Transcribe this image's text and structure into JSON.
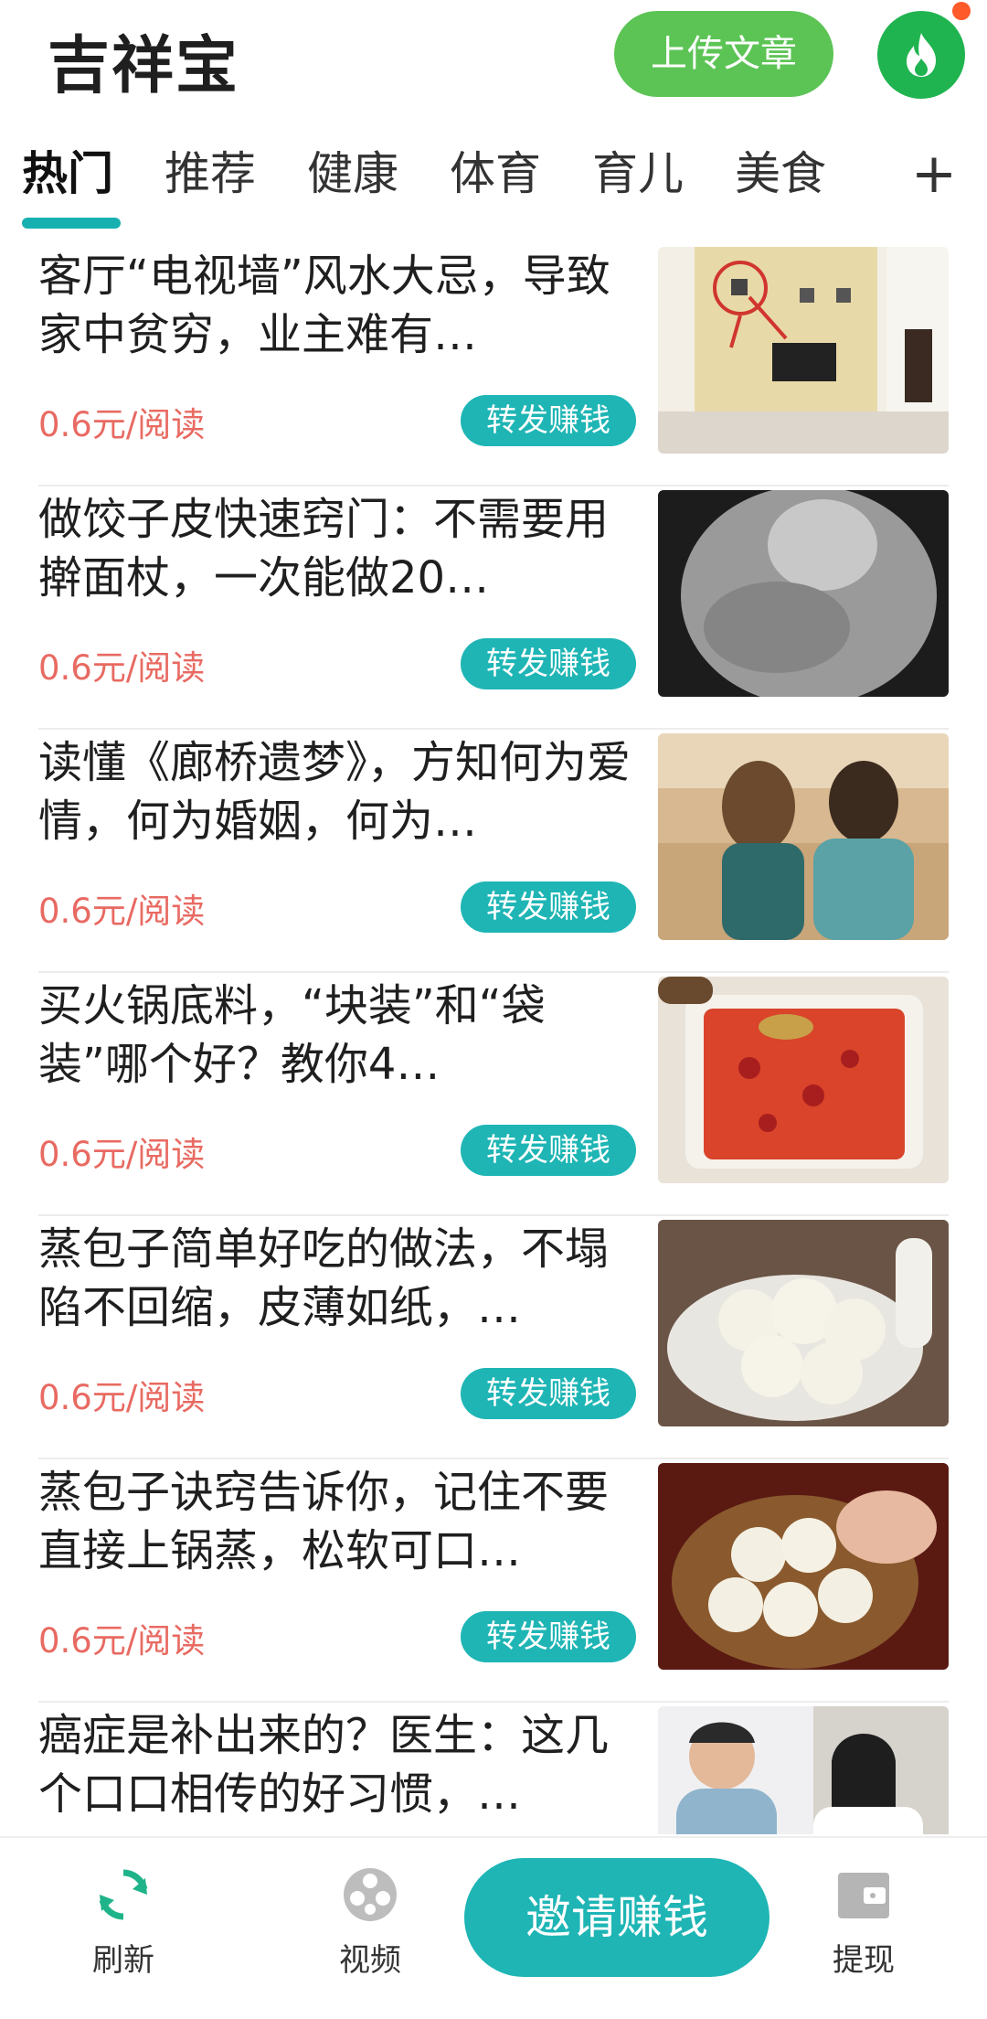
{
  "header": {
    "app_title": "吉祥宝",
    "upload_label": "上传文章"
  },
  "tabs": [
    {
      "label": "热门"
    },
    {
      "label": "推荐"
    },
    {
      "label": "健康"
    },
    {
      "label": "体育"
    },
    {
      "label": "育儿"
    },
    {
      "label": "美食"
    }
  ],
  "tab_add_label": "+",
  "articles": [
    {
      "title": "客厅“电视墙”风水大忌，导致家中贫穷，业主难有…",
      "price": "0.6元/阅读",
      "share_label": "转发赚钱"
    },
    {
      "title": "做饺子皮快速窍门：不需要用擀面杖，一次能做20…",
      "price": "0.6元/阅读",
      "share_label": "转发赚钱"
    },
    {
      "title": "读懂《廊桥遗梦》，方知何为爱情，何为婚姻，何为…",
      "price": "0.6元/阅读",
      "share_label": "转发赚钱"
    },
    {
      "title": "买火锅底料，“块装”和“袋装”哪个好？教你4…",
      "price": "0.6元/阅读",
      "share_label": "转发赚钱"
    },
    {
      "title": "蒸包子简单好吃的做法，不塌陷不回缩，皮薄如纸，…",
      "price": "0.6元/阅读",
      "share_label": "转发赚钱"
    },
    {
      "title": "蒸包子诀窍告诉你，记住不要直接上锅蒸，松软可口…",
      "price": "0.6元/阅读",
      "share_label": "转发赚钱"
    },
    {
      "title": "癌症是补出来的？医生：这几个口口相传的好习惯，…",
      "price": "",
      "share_label": ""
    }
  ],
  "bottom_nav": {
    "refresh_label": "刷新",
    "video_label": "视频",
    "invite_label": "邀请赚钱",
    "withdraw_label": "提现"
  },
  "colors": {
    "accent_teal": "#1fb5b5",
    "upload_green": "#5cc455",
    "hot_green": "#20b450",
    "price_red": "#e86a62"
  }
}
